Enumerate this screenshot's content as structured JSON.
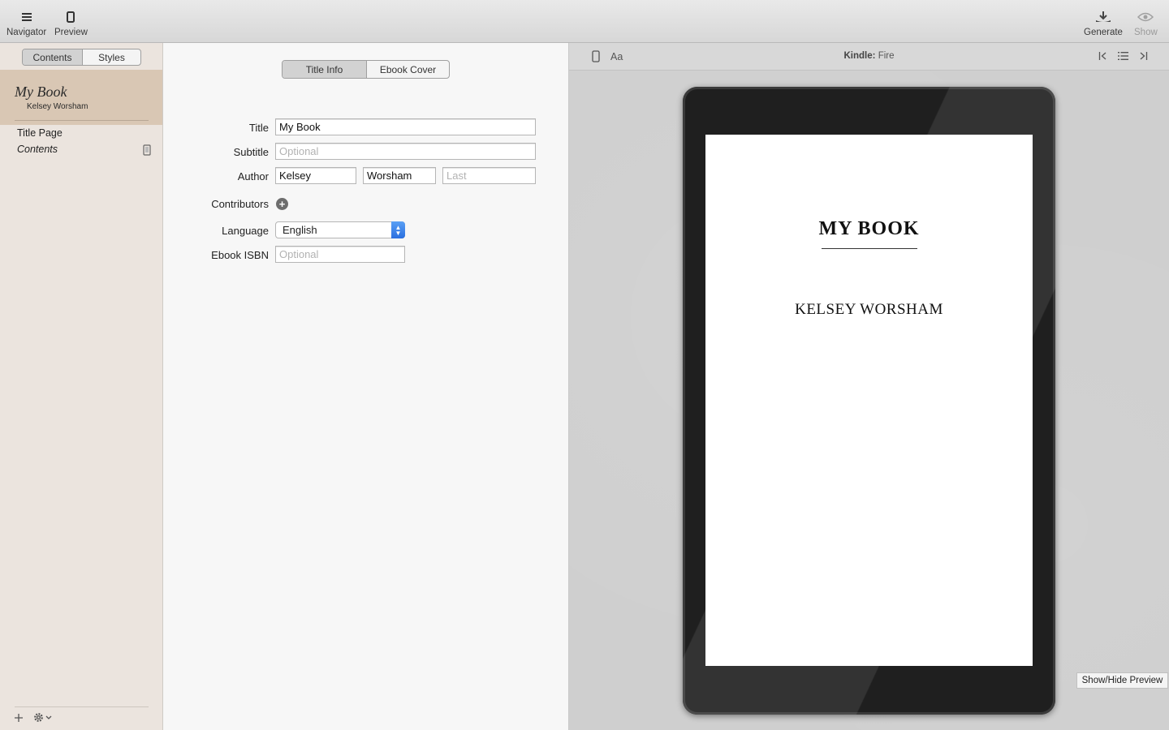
{
  "toolbar": {
    "navigator_label": "Navigator",
    "preview_label": "Preview",
    "generate_label": "Generate",
    "show_label": "Show"
  },
  "sidebar": {
    "tabs": [
      {
        "label": "Contents",
        "active": true
      },
      {
        "label": "Styles",
        "active": false
      }
    ],
    "book": {
      "title": "My Book",
      "author": "Kelsey Worsham"
    },
    "items": [
      {
        "label": "Title Page"
      },
      {
        "label": "Contents"
      }
    ]
  },
  "editor": {
    "tabs": [
      {
        "label": "Title Info",
        "active": true
      },
      {
        "label": "Ebook Cover",
        "active": false
      }
    ],
    "labels": {
      "title": "Title",
      "subtitle": "Subtitle",
      "author": "Author",
      "contributors": "Contributors",
      "language": "Language",
      "isbn": "Ebook ISBN"
    },
    "fields": {
      "title_value": "My Book",
      "subtitle_placeholder": "Optional",
      "author_first": "Kelsey",
      "author_middle": "Worsham",
      "author_last_placeholder": "Last",
      "language_value": "English",
      "isbn_placeholder": "Optional"
    }
  },
  "preview": {
    "font_button": "Aa",
    "device_name_bold": "Kindle:",
    "device_model": "Fire",
    "screen_title": "MY BOOK",
    "screen_author": "KELSEY WORSHAM",
    "tooltip": "Show/Hide Preview"
  },
  "colors": {
    "sidebar_bg": "#ebe4de",
    "book_card_bg": "#d9c7b4",
    "select_accent": "#2a6fe0"
  }
}
